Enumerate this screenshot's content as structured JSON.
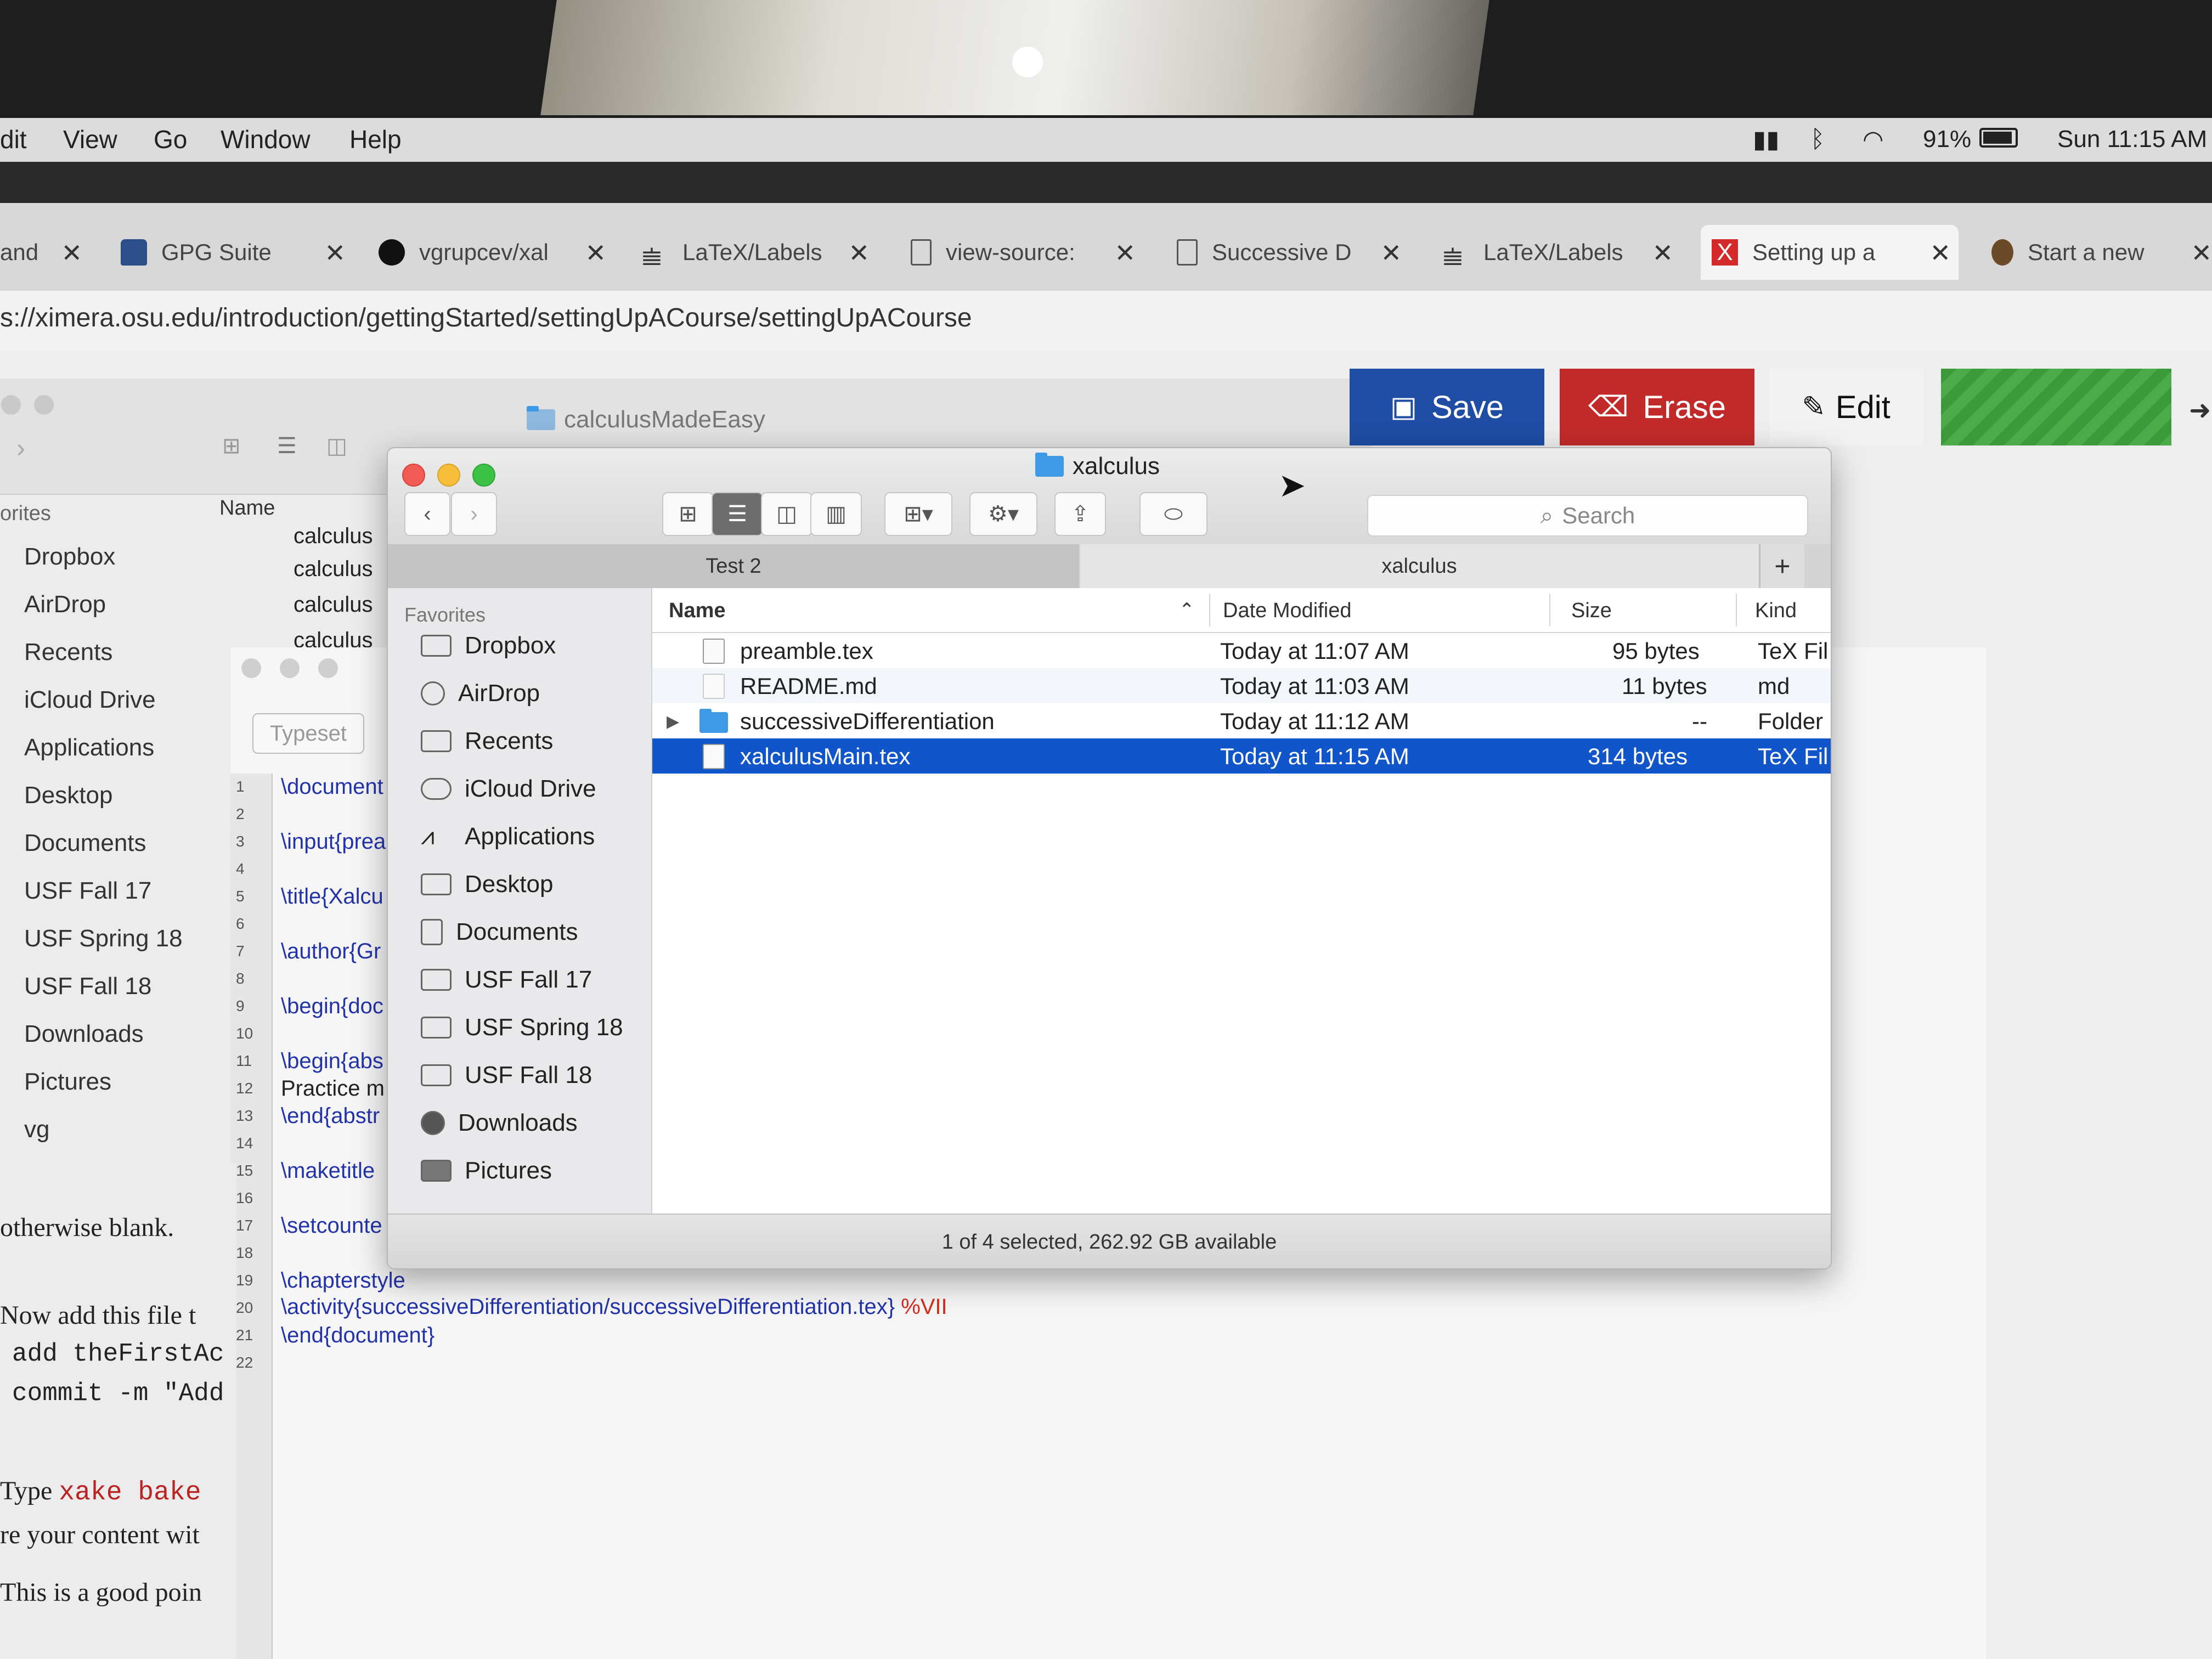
{
  "menubar": {
    "items": [
      "dit",
      "View",
      "Go",
      "Window",
      "Help"
    ],
    "battery": "91%",
    "clock": "Sun 11:15 AM"
  },
  "tabs": [
    {
      "label": "and",
      "active": false
    },
    {
      "label": "GPG Suite",
      "active": false
    },
    {
      "label": "vgrupcev/xal",
      "active": false
    },
    {
      "label": "LaTeX/Labels",
      "active": false
    },
    {
      "label": "view-source:",
      "active": false
    },
    {
      "label": "Successive D",
      "active": false
    },
    {
      "label": "LaTeX/Labels",
      "active": false
    },
    {
      "label": "Setting up a",
      "active": true
    },
    {
      "label": "Start a new",
      "active": false
    }
  ],
  "url": "s://ximera.osu.edu/introduction/gettingStarted/settingUpACourse/settingUpACourse",
  "ximera_buttons": {
    "save": "Save",
    "erase": "Erase",
    "edit": "Edit",
    "colors": {
      "save": "#1f4da3",
      "erase": "#c22a2a",
      "green": "#3c9a3a"
    }
  },
  "back_finder": {
    "title": "calculusMadeEasy",
    "sidebar_heading": "orites",
    "sidebar": [
      "Dropbox",
      "AirDrop",
      "Recents",
      "iCloud Drive",
      "Applications",
      "Desktop",
      "Documents",
      "USF Fall 17",
      "USF Spring 18",
      "USF Fall 18",
      "Downloads",
      "Pictures",
      "vg"
    ],
    "name_header": "Name",
    "files": [
      "calculus",
      "calculus",
      "calculus",
      "calculus"
    ]
  },
  "editor": {
    "typeset": "Typeset",
    "line_numbers": [
      "1",
      "2",
      "3",
      "4",
      "5",
      "6",
      "7",
      "8",
      "9",
      "10",
      "11",
      "12",
      "13",
      "14",
      "15",
      "16",
      "17",
      "18",
      "19",
      "20",
      "21",
      "22"
    ],
    "lines": [
      {
        "n": "1",
        "text": "\\document"
      },
      {
        "n": "3",
        "text": "\\input{prea"
      },
      {
        "n": "5",
        "text": "\\title{Xalcu"
      },
      {
        "n": "7",
        "text": "\\author{Gr"
      },
      {
        "n": "9",
        "text": "\\begin{doc"
      },
      {
        "n": "11",
        "text": "\\begin{abs"
      },
      {
        "n": "12",
        "text": "Practice m"
      },
      {
        "n": "13",
        "text": "\\end{abstr"
      },
      {
        "n": "15",
        "text": "\\maketitle"
      },
      {
        "n": "17",
        "text": "\\setcounte"
      },
      {
        "n": "19",
        "text": "\\chapterstyle"
      },
      {
        "n": "20",
        "text": "\\activity{successiveDifferentiation/successiveDifferentiation.tex}",
        "comment": "%VII"
      },
      {
        "n": "21",
        "text": "\\end{document}"
      }
    ]
  },
  "web_text": {
    "line1": "otherwise blank.",
    "line2": "Now add this file t",
    "line3": "add theFirstAc",
    "line4": "commit -m \"Add",
    "line5_prefix": "Type",
    "line5_code": "xake bake",
    "line6": "re your content wit",
    "line7": "This is a good poin"
  },
  "finder": {
    "title": "xalculus",
    "search_placeholder": "Search",
    "tabs": [
      "Test 2",
      "xalculus"
    ],
    "add_tab": "+",
    "sidebar_heading": "Favorites",
    "sidebar": [
      "Dropbox",
      "AirDrop",
      "Recents",
      "iCloud Drive",
      "Applications",
      "Desktop",
      "Documents",
      "USF Fall 17",
      "USF Spring 18",
      "USF Fall 18",
      "Downloads",
      "Pictures"
    ],
    "columns": {
      "name": "Name",
      "date": "Date Modified",
      "size": "Size",
      "kind": "Kind"
    },
    "rows": [
      {
        "name": "preamble.tex",
        "date": "Today at 11:07 AM",
        "size": "95 bytes",
        "kind": "TeX Fil",
        "selected": false,
        "folder": false
      },
      {
        "name": "README.md",
        "date": "Today at 11:03 AM",
        "size": "11 bytes",
        "kind": "md",
        "selected": false,
        "folder": false
      },
      {
        "name": "successiveDifferentiation",
        "date": "Today at 11:12 AM",
        "size": "--",
        "kind": "Folder",
        "selected": false,
        "folder": true
      },
      {
        "name": "xalculusMain.tex",
        "date": "Today at 11:15 AM",
        "size": "314 bytes",
        "kind": "TeX Fil",
        "selected": true,
        "folder": false
      }
    ],
    "status": "1 of 4 selected, 262.92 GB available",
    "selection_color": "#1055c9"
  }
}
